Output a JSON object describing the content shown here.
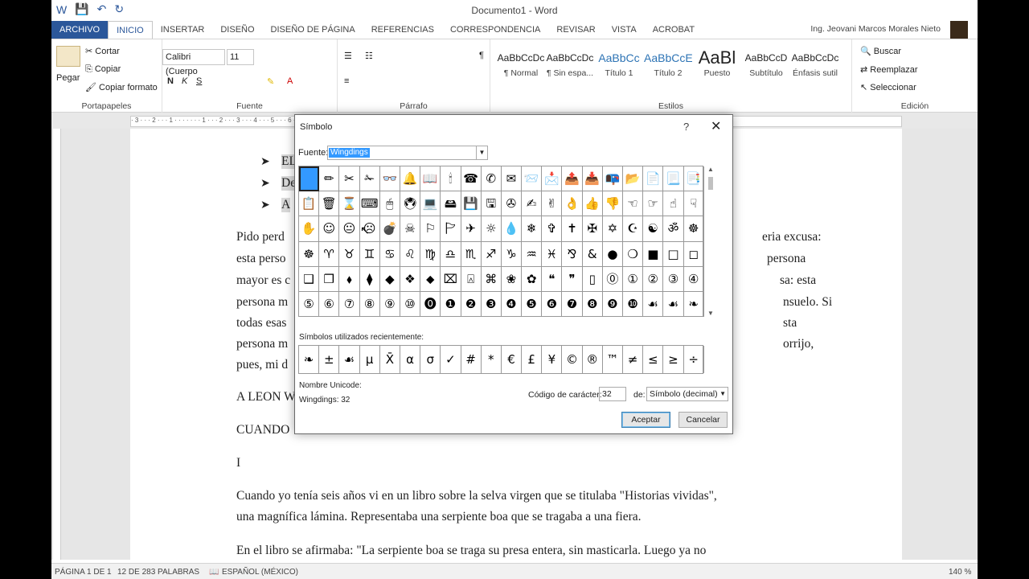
{
  "app": {
    "window_title": "Documento1 - Word",
    "user_name": "Ing. Jeovani Marcos Morales Nieto",
    "tabs": [
      "ARCHIVO",
      "INICIO",
      "INSERTAR",
      "DISEÑO",
      "DISEÑO DE PÁGINA",
      "REFERENCIAS",
      "CORRESPONDENCIA",
      "REVISAR",
      "VISTA",
      "ACROBAT"
    ]
  },
  "ribbon": {
    "clipboard": {
      "paste": "Pegar",
      "cut": "Cortar",
      "copy": "Copiar",
      "format_painter": "Copiar formato",
      "label": "Portapapeles"
    },
    "font": {
      "name": "Calibri (Cuerpo",
      "size": "11",
      "label": "Fuente"
    },
    "paragraph": {
      "label": "Párrafo"
    },
    "styles": {
      "label": "Estilos",
      "items": [
        {
          "preview": "AaBbCcDc",
          "name": "¶ Normal"
        },
        {
          "preview": "AaBbCcDc",
          "name": "¶ Sin espa..."
        },
        {
          "preview": "AaBbCc",
          "name": "Título 1"
        },
        {
          "preview": "AaBbCcE",
          "name": "Título 2"
        },
        {
          "preview": "AaBl",
          "name": "Puesto"
        },
        {
          "preview": "AaBbCcD",
          "name": "Subtítulo"
        },
        {
          "preview": "AaBbCcDc",
          "name": "Énfasis sutil"
        }
      ]
    },
    "editing": {
      "find": "Buscar",
      "replace": "Reemplazar",
      "select": "Seleccionar",
      "label": "Edición"
    }
  },
  "document": {
    "bullets": [
      "EL",
      "De",
      "A"
    ],
    "lines": [
      "Pido perd",
      "esta perso",
      "mayor es c",
      "persona m",
      "todas esas",
      "persona m",
      "pues, mi d"
    ],
    "right_fragments": [
      "eria excusa:",
      "persona",
      "sa: esta",
      "nsuelo. Si",
      "sta",
      "orrijo,"
    ],
    "heading1": "A LEON W",
    "heading2": "CUANDO",
    "roman": "I",
    "para1_line1": "Cuando yo tenía seis años vi en un libro sobre la selva virgen que se titulaba \"Historias vividas\",",
    "para1_line2": "una magnífica lámina. Representaba una serpiente boa que se tragaba a una fiera.",
    "para2_line1": "En el libro se afirmaba: \"La serpiente boa se traga su presa entera, sin masticarla. Luego ya no"
  },
  "status": {
    "page": "PÁGINA 1 DE 1",
    "words": "12 DE 283 PALABRAS",
    "language": "ESPAÑOL (MÉXICO)",
    "zoom": "140 %"
  },
  "dialog": {
    "title": "Símbolo",
    "help": "?",
    "font_label": "Fuente:",
    "font_value": "Wingdings",
    "symbols": [
      "",
      "✏",
      "✂",
      "✁",
      "👓",
      "🔔",
      "📖",
      "🕯",
      "☎",
      "✆",
      "✉",
      "📨",
      "📩",
      "📤",
      "📥",
      "📭",
      "📂",
      "📄",
      "📃",
      "📑",
      "📋",
      "🗑",
      "⌛",
      "⌨",
      "🖱",
      "🖲",
      "💻",
      "🖴",
      "💾",
      "🖫",
      "✇",
      "✍",
      "✌",
      "👌",
      "👍",
      "👎",
      "☜",
      "☞",
      "☝",
      "☟",
      "✋",
      "☺",
      "😐",
      "☹",
      "💣",
      "☠",
      "⚐",
      "🏱",
      "✈",
      "☼",
      "💧",
      "❄",
      "✞",
      "✝",
      "✠",
      "✡",
      "☪",
      "☯",
      "ॐ",
      "☸",
      "☸",
      "♈",
      "♉",
      "♊",
      "♋",
      "♌",
      "♍",
      "♎",
      "♏",
      "♐",
      "♑",
      "♒",
      "♓",
      "⅋",
      "&",
      "●",
      "❍",
      "■",
      "□",
      "◻",
      "❑",
      "❒",
      "⬧",
      "⧫",
      "◆",
      "❖",
      "⬥",
      "⌧",
      "⍓",
      "⌘",
      "❀",
      "✿",
      "❝",
      "❞",
      "▯",
      "⓪",
      "①",
      "②",
      "③",
      "④",
      "⑤",
      "⑥",
      "⑦",
      "⑧",
      "⑨",
      "⑩",
      "⓿",
      "❶",
      "❷",
      "❸",
      "❹",
      "❺",
      "❻",
      "❼",
      "❽",
      "❾",
      "❿",
      "☙",
      "☙",
      "❧"
    ],
    "recent_label": "Símbolos utilizados recientemente:",
    "recent": [
      "❧",
      "±",
      "☙",
      "µ",
      "X̄",
      "α",
      "σ",
      "✓",
      "#",
      "*",
      "€",
      "£",
      "¥",
      "©",
      "®",
      "™",
      "≠",
      "≤",
      "≥",
      "÷"
    ],
    "unicode_label": "Nombre Unicode:",
    "unicode_value": "Wingdings: 32",
    "code_label": "Código de carácter:",
    "code_value": "32",
    "from_label": "de:",
    "from_value": "Símbolo (decimal)",
    "ok": "Aceptar",
    "cancel": "Cancelar"
  }
}
